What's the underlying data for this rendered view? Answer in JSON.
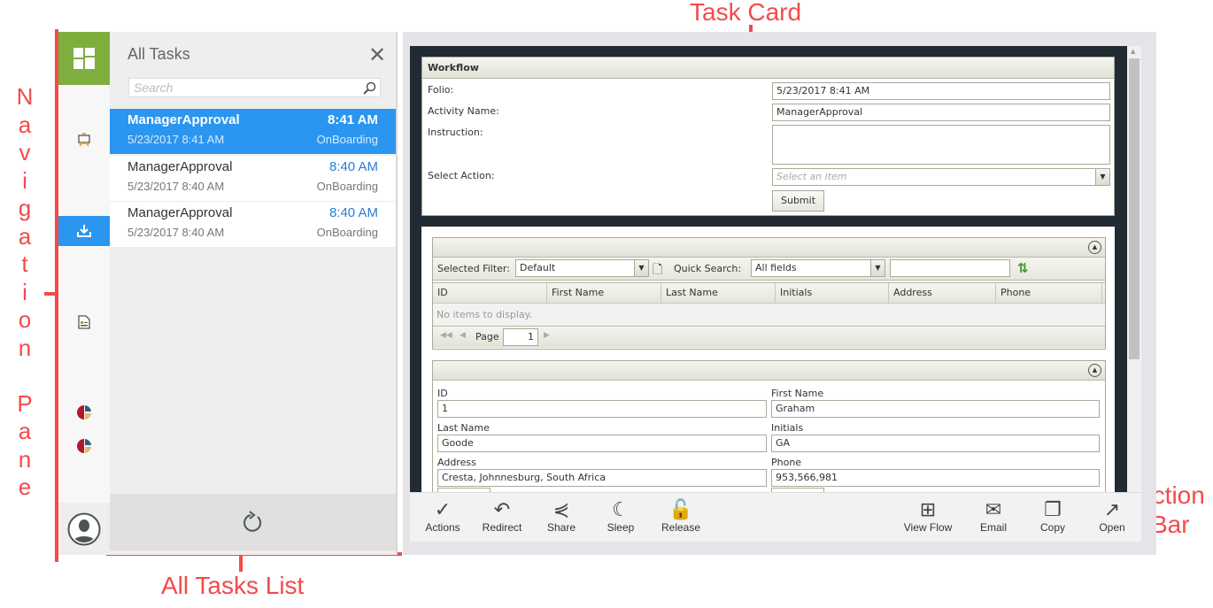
{
  "annotations": {
    "task_card": "Task Card",
    "navigation_pane": [
      "N",
      "a",
      "v",
      "i",
      "g",
      "a",
      "t",
      "i",
      "o",
      "n",
      "",
      "P",
      "a",
      "n",
      "e"
    ],
    "all_tasks_list": "All Tasks List",
    "action_bar_1": "Action",
    "action_bar_2": "Bar"
  },
  "task_list": {
    "title": "All Tasks",
    "search_placeholder": "Search",
    "items": [
      {
        "name": "ManagerApproval",
        "time": "8:41 AM",
        "date": "5/23/2017 8:41 AM",
        "category": "OnBoarding",
        "selected": true
      },
      {
        "name": "ManagerApproval",
        "time": "8:40 AM",
        "date": "5/23/2017 8:40 AM",
        "category": "OnBoarding"
      },
      {
        "name": "ManagerApproval",
        "time": "8:40 AM",
        "date": "5/23/2017 8:40 AM",
        "category": "OnBoarding"
      }
    ]
  },
  "workflow": {
    "title": "Workflow",
    "folio_label": "Folio:",
    "folio": "5/23/2017 8:41 AM",
    "activity_label": "Activity Name:",
    "activity": "ManagerApproval",
    "instruction_label": "Instruction:",
    "instruction": "",
    "action_label": "Select Action:",
    "action_placeholder": "Select an item",
    "submit": "Submit"
  },
  "grid": {
    "filter_label": "Selected Filter:",
    "filter": "Default",
    "quick_label": "Quick Search:",
    "quick": "All fields",
    "quick_text": "",
    "columns": [
      "ID",
      "First Name",
      "Last Name",
      "Initials",
      "Address",
      "Phone"
    ],
    "empty": "No items to display.",
    "page_label": "Page",
    "page": "1"
  },
  "form": {
    "id_label": "ID",
    "id": "1",
    "first_label": "First Name",
    "first": "Graham",
    "last_label": "Last Name",
    "last": "Goode",
    "initials_label": "Initials",
    "initials": "GA",
    "address_label": "Address",
    "address": "Cresta, Johnnesburg, South Africa",
    "phone_label": "Phone",
    "phone": "953,566,981"
  },
  "action_bar": {
    "left": [
      "Actions",
      "Redirect",
      "Share",
      "Sleep",
      "Release"
    ],
    "right": [
      "View Flow",
      "Email",
      "Copy",
      "Open"
    ]
  },
  "colors": {
    "accent": "#2a96f0",
    "nav_green": "#7fae3f",
    "annotation": "#f44a4a"
  }
}
